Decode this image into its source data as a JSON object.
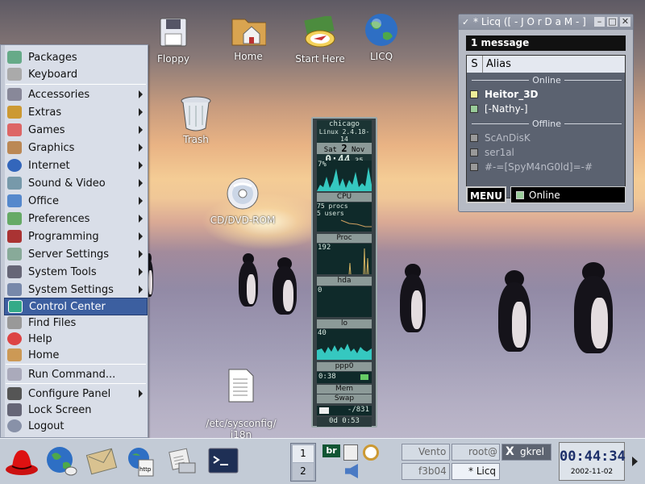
{
  "desktop": {
    "icons": [
      {
        "label": "Floppy"
      },
      {
        "label": "Home"
      },
      {
        "label": "Start Here"
      },
      {
        "label": "LICQ"
      },
      {
        "label": "Trash"
      },
      {
        "label": "CD/DVD-ROM"
      },
      {
        "label": "/etc/sysconfig/\ni18n"
      }
    ]
  },
  "start_menu": {
    "items": [
      {
        "label": "Packages",
        "submenu": false
      },
      {
        "label": "Keyboard",
        "submenu": false
      },
      {
        "label": "Accessories",
        "submenu": true
      },
      {
        "label": "Extras",
        "submenu": true
      },
      {
        "label": "Games",
        "submenu": true
      },
      {
        "label": "Graphics",
        "submenu": true
      },
      {
        "label": "Internet",
        "submenu": true
      },
      {
        "label": "Sound & Video",
        "submenu": true
      },
      {
        "label": "Office",
        "submenu": true
      },
      {
        "label": "Preferences",
        "submenu": true
      },
      {
        "label": "Programming",
        "submenu": true
      },
      {
        "label": "Server Settings",
        "submenu": true
      },
      {
        "label": "System Tools",
        "submenu": true
      },
      {
        "label": "System Settings",
        "submenu": true
      },
      {
        "label": "Control Center",
        "submenu": false,
        "selected": true
      },
      {
        "label": "Find Files",
        "submenu": false
      },
      {
        "label": "Help",
        "submenu": false
      },
      {
        "label": "Home",
        "submenu": false
      },
      {
        "label": "Run Command...",
        "submenu": false
      },
      {
        "label": "Configure Panel",
        "submenu": true
      },
      {
        "label": "Lock Screen",
        "submenu": false
      },
      {
        "label": "Logout",
        "submenu": false
      }
    ]
  },
  "monitor": {
    "city": "chicago",
    "kernel": "Linux 2.4.18-14",
    "day": "Sat",
    "date": "2",
    "month": "Nov",
    "time": "0:44",
    "seconds": "35",
    "cpu_percent": "7%",
    "cpu_label": "CPU",
    "procs": "75 procs",
    "users": "5 users",
    "proc_label": "Proc",
    "proc_value": "192",
    "hda_label": "hda",
    "hda_value": "0",
    "lo_label": "lo",
    "lo_value": "40",
    "ppp_label": "ppp0",
    "ppp_value": "0:38",
    "mem_label": "Mem",
    "swap_label": "Swap",
    "mail_value": "-/831",
    "uptime": "0d  0:53"
  },
  "licq": {
    "title": "* Licq ([ - J O r D a M - ]",
    "message_bar": "1 message",
    "col_status": "S",
    "col_alias": "Alias",
    "group_online": "Online",
    "group_offline": "Offline",
    "online_contacts": [
      "Heitor_3D",
      "[-Nathy-]"
    ],
    "offline_contacts": [
      "ScAnDisK",
      "ser1al",
      "#-=[SpyM4nG0ld]=-#"
    ],
    "menu_button": "MENU",
    "status": "Online"
  },
  "panel": {
    "pager_1": "1",
    "pager_2": "2",
    "tasks": [
      "Vento",
      "root@",
      "gkrel",
      "f3b04",
      "* Licq",
      "X"
    ],
    "applet_br": "br",
    "clock_time": "00:44:34",
    "clock_date": "2002-11-02"
  },
  "colors": {
    "menu_selected": "#3c5fa0",
    "panel_bg": "#c3cbd6",
    "clock_text": "#1c2f6a"
  }
}
